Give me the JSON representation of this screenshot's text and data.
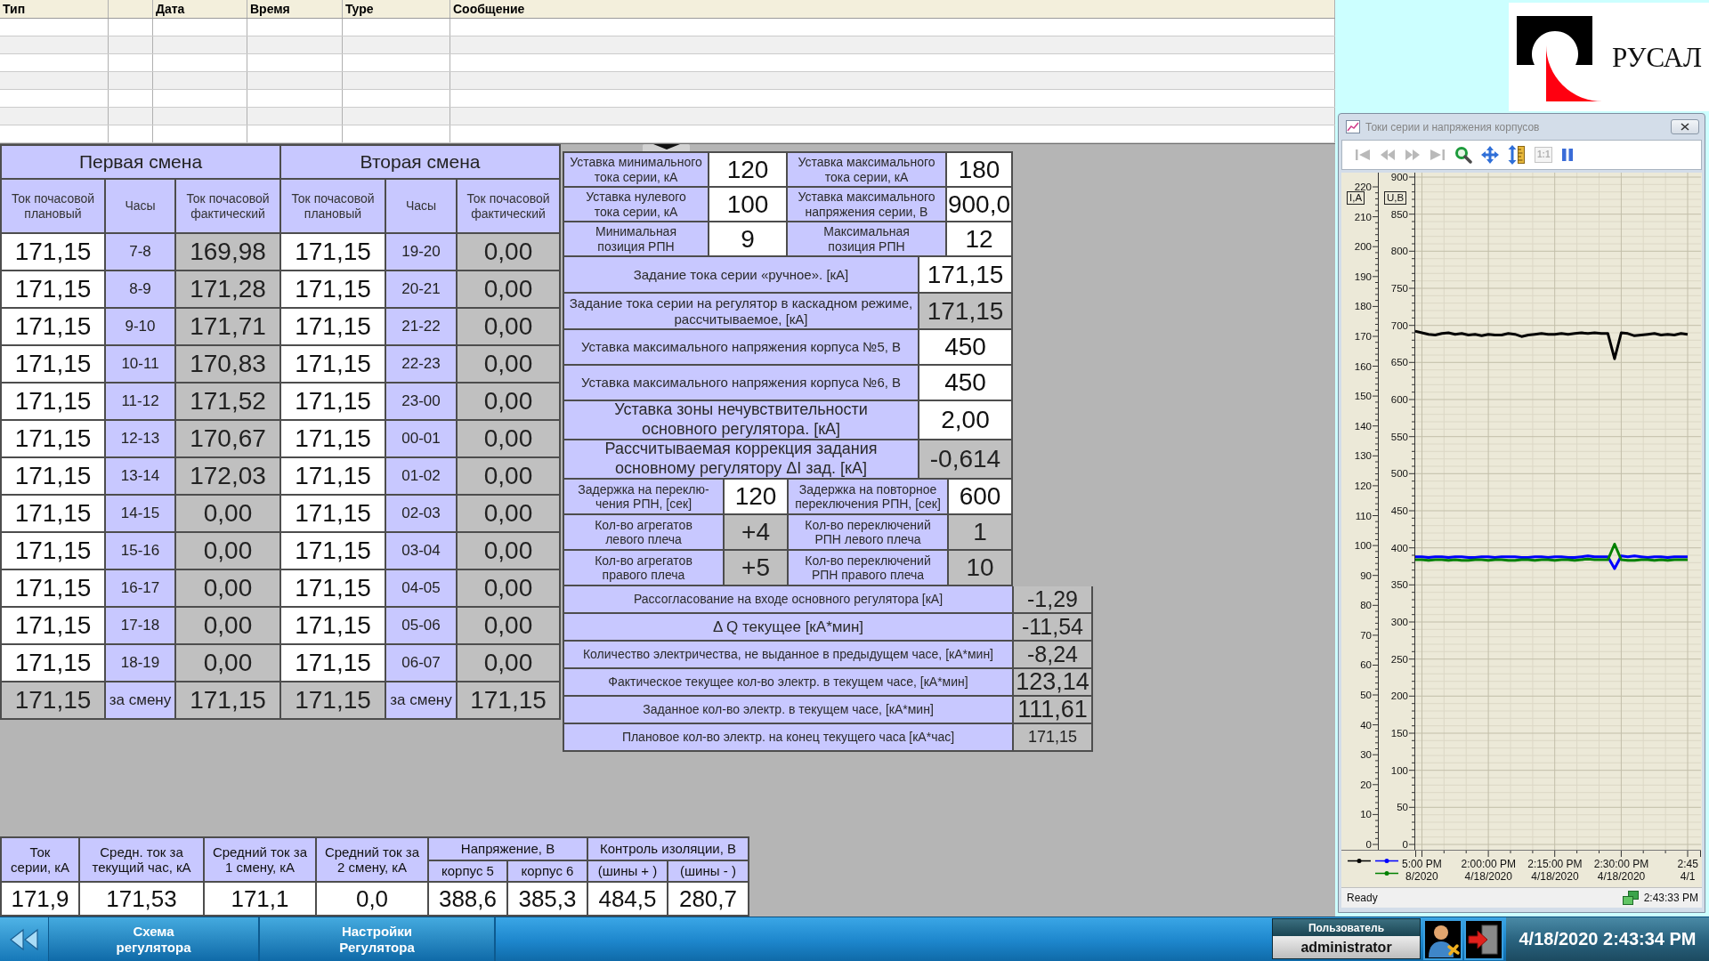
{
  "event_log": {
    "columns": [
      {
        "kind": "text",
        "label": "Тип"
      },
      {
        "kind": "blank"
      },
      {
        "kind": "text",
        "label": "Дата"
      },
      {
        "kind": "text",
        "label": "Время"
      },
      {
        "kind": "text",
        "label": "Type"
      },
      {
        "kind": "text",
        "label": "Сообщение"
      }
    ]
  },
  "logo": {
    "text": "РУСАЛ"
  },
  "shift_table": {
    "shifts": [
      {
        "title": "Первая смена",
        "columns": [
          "Ток почасовой плановый",
          "Часы",
          "Ток почасовой фактический"
        ],
        "rows": [
          {
            "planned": "171,15",
            "hours": "7-8",
            "actual": "169,98"
          },
          {
            "planned": "171,15",
            "hours": "8-9",
            "actual": "171,28"
          },
          {
            "planned": "171,15",
            "hours": "9-10",
            "actual": "171,71"
          },
          {
            "planned": "171,15",
            "hours": "10-11",
            "actual": "170,83"
          },
          {
            "planned": "171,15",
            "hours": "11-12",
            "actual": "171,52"
          },
          {
            "planned": "171,15",
            "hours": "12-13",
            "actual": "170,67"
          },
          {
            "planned": "171,15",
            "hours": "13-14",
            "actual": "172,03"
          },
          {
            "planned": "171,15",
            "hours": "14-15",
            "actual": "0,00"
          },
          {
            "planned": "171,15",
            "hours": "15-16",
            "actual": "0,00"
          },
          {
            "planned": "171,15",
            "hours": "16-17",
            "actual": "0,00"
          },
          {
            "planned": "171,15",
            "hours": "17-18",
            "actual": "0,00"
          },
          {
            "planned": "171,15",
            "hours": "18-19",
            "actual": "0,00"
          }
        ],
        "total": {
          "planned": "171,15",
          "hours": "за смену",
          "actual": "171,15"
        }
      },
      {
        "title": "Вторая смена",
        "columns": [
          "Ток почасовой плановый",
          "Часы",
          "Ток почасовой фактический"
        ],
        "rows": [
          {
            "planned": "171,15",
            "hours": "19-20",
            "actual": "0,00"
          },
          {
            "planned": "171,15",
            "hours": "20-21",
            "actual": "0,00"
          },
          {
            "planned": "171,15",
            "hours": "21-22",
            "actual": "0,00"
          },
          {
            "planned": "171,15",
            "hours": "22-23",
            "actual": "0,00"
          },
          {
            "planned": "171,15",
            "hours": "23-00",
            "actual": "0,00"
          },
          {
            "planned": "171,15",
            "hours": "00-01",
            "actual": "0,00"
          },
          {
            "planned": "171,15",
            "hours": "01-02",
            "actual": "0,00"
          },
          {
            "planned": "171,15",
            "hours": "02-03",
            "actual": "0,00"
          },
          {
            "planned": "171,15",
            "hours": "03-04",
            "actual": "0,00"
          },
          {
            "planned": "171,15",
            "hours": "04-05",
            "actual": "0,00"
          },
          {
            "planned": "171,15",
            "hours": "05-06",
            "actual": "0,00"
          },
          {
            "planned": "171,15",
            "hours": "06-07",
            "actual": "0,00"
          }
        ],
        "total": {
          "planned": "171,15",
          "hours": "за смену",
          "actual": "171,15"
        }
      }
    ]
  },
  "settings": {
    "limits": [
      {
        "cells": [
          {
            "label": "Уставка минимального\nтока серии, кА",
            "value": "120",
            "editable": true
          },
          {
            "label": "Уставка максимального\nтока серии, кА",
            "value": "180",
            "editable": true
          }
        ]
      },
      {
        "cells": [
          {
            "label": "Уставка нулевого\nтока серии, кА",
            "value": "100",
            "editable": true
          },
          {
            "label": "Уставка максимального\nнапряжения серии, В",
            "value": "900,0",
            "editable": true
          }
        ]
      },
      {
        "cells": [
          {
            "label": "Минимальная\nпозиция РПН",
            "value": "9",
            "editable": true
          },
          {
            "label": "Максимальная\nпозиция РПН",
            "value": "12",
            "editable": true
          }
        ]
      }
    ],
    "tasks": [
      {
        "label": "Задание тока серии «ручное». [кА]",
        "value": "171,15",
        "editable": true
      },
      {
        "label": "Задание тока серии на регулятор в каскадном режиме,\nрассчитываемое, [кА]",
        "value": "171,15",
        "editable": false
      },
      {
        "label": "Уставка максимального напряжения корпуса №5, В",
        "value": "450",
        "editable": true
      },
      {
        "label": "Уставка максимального напряжения корпуса №6, В",
        "value": "450",
        "editable": true
      },
      {
        "label": "Уставка зоны нечувствительности\nосновного регулятора. [кА]",
        "value": "2,00",
        "editable": true
      },
      {
        "label": "Рассчитываемая коррекция задания\nосновному регулятору ΔI зад. [кА]",
        "value": "-0,614",
        "editable": false
      }
    ],
    "switching": [
      {
        "cells": [
          {
            "label": "Задержка на переклю-\nчения РПН, [сек]",
            "value": "120",
            "editable": true
          },
          {
            "label": "Задержка на повторное\nпереключения РПН, [сек]",
            "value": "600",
            "editable": true
          }
        ]
      },
      {
        "cells": [
          {
            "label": "Кол-во агрегатов\nлевого плеча",
            "value": "+4",
            "editable": false
          },
          {
            "label": "Кол-во переключений\nРПН левого плеча",
            "value": "1",
            "editable": false
          }
        ]
      },
      {
        "cells": [
          {
            "label": "Кол-во агрегатов\nправого плеча",
            "value": "+5",
            "editable": false
          },
          {
            "label": "Кол-во переключений\nРПН правого плеча",
            "value": "10",
            "editable": false
          }
        ]
      }
    ],
    "energy": [
      {
        "label": "Рассогласование на входе основного регулятора [кА]",
        "value": "-1,29",
        "editable": false
      },
      {
        "label": "Δ Q текущее [кА*мин]",
        "value": "-11,54",
        "editable": false
      },
      {
        "label": "Количество электричества, не выданное в предыдущем часе, [кА*мин]",
        "value": "-8,24",
        "editable": false
      },
      {
        "label": "Фактическое текущее кол-во электр. в текущем часе, [кА*мин]",
        "value": "123,14",
        "editable": false
      },
      {
        "label": "Заданное кол-во электр. в текущем часе, [кА*мин]",
        "value": "111,61",
        "editable": false
      },
      {
        "label": "Плановое кол-во электр. на конец текущего часа [кА*час]",
        "value": "171,15",
        "editable": false
      }
    ]
  },
  "readings": [
    {
      "kind": "single",
      "label": "Ток\nсерии, кА",
      "value": "171,9"
    },
    {
      "kind": "single",
      "label": "Средн. ток за\nтекущий час, кА",
      "value": "171,53"
    },
    {
      "kind": "single",
      "label": "Средний ток за\n1 смену, кА",
      "value": "171,1"
    },
    {
      "kind": "single",
      "label": "Средний ток за\n2 смену, кА",
      "value": "0,0"
    },
    {
      "kind": "group",
      "label": "Напряжение, В",
      "items": [
        {
          "label": "корпус 5",
          "value": "388,6"
        },
        {
          "label": "корпус 6",
          "value": "385,3"
        }
      ]
    },
    {
      "kind": "group",
      "label": "Контроль изоляции, В",
      "items": [
        {
          "label": "(шины + )",
          "value": "484,5"
        },
        {
          "label": "(шины - )",
          "value": "280,7"
        }
      ]
    }
  ],
  "chart_window": {
    "title": "Токи серии и напряжения корпусов",
    "toolbar": [
      {
        "kind": "first",
        "disabled": true
      },
      {
        "kind": "prev",
        "disabled": true
      },
      {
        "kind": "next",
        "disabled": true
      },
      {
        "kind": "last",
        "disabled": true
      },
      {
        "kind": "zoom",
        "disabled": false
      },
      {
        "kind": "pan",
        "disabled": false
      },
      {
        "kind": "scale",
        "disabled": false
      },
      {
        "kind": "fit",
        "label": "1:1",
        "disabled": true
      },
      {
        "kind": "pause",
        "disabled": false
      }
    ],
    "current_axis": {
      "label": "I,A",
      "ticks": [
        "220",
        "210",
        "200",
        "190",
        "180",
        "170",
        "160",
        "150",
        "140",
        "130",
        "120",
        "110",
        "100",
        "90",
        "80",
        "70",
        "60",
        "50",
        "40",
        "30",
        "20",
        "10",
        "0"
      ]
    },
    "chart_data": {
      "type": "line",
      "ylabel": "U,B",
      "grid": true,
      "categories": [
        null,
        "5:00 PM\n8/2020",
        null,
        null,
        null,
        null,
        null,
        null,
        null,
        null,
        null,
        "2:00:00 PM\n4/18/2020",
        null,
        null,
        null,
        null,
        null,
        null,
        null,
        null,
        null,
        "2:15:00 PM\n4/18/2020",
        null,
        null,
        null,
        null,
        null,
        null,
        null,
        null,
        null,
        "2:30:00 PM\n4/18/2020",
        null,
        null,
        null,
        null,
        null,
        null,
        null,
        null,
        null,
        "2:45\n4/1"
      ],
      "ylim": [
        0,
        900
      ],
      "yticks": [
        0,
        50,
        100,
        150,
        200,
        250,
        300,
        350,
        400,
        450,
        500,
        550,
        600,
        650,
        700,
        750,
        800,
        850,
        900
      ],
      "series": [
        {
          "color": "#000000",
          "values": [
            692,
            690,
            688,
            687,
            689,
            690,
            688,
            689,
            687,
            688,
            686,
            688,
            687,
            687,
            689,
            688,
            685,
            687,
            688,
            689,
            688,
            688,
            689,
            688,
            689,
            690,
            689,
            690,
            689,
            689,
            655,
            690,
            689,
            686,
            687,
            688,
            689,
            687,
            688,
            687,
            689,
            688
          ]
        },
        {
          "color": "#0000ff",
          "values": [
            388,
            388,
            387,
            388,
            388,
            387,
            388,
            388,
            387,
            387,
            388,
            388,
            387,
            388,
            388,
            388,
            387,
            387,
            388,
            388,
            387,
            388,
            388,
            387,
            387,
            388,
            389,
            388,
            388,
            388,
            372,
            389,
            388,
            389,
            388,
            387,
            388,
            388,
            387,
            388,
            388,
            388
          ]
        },
        {
          "color": "#008000",
          "values": [
            384,
            384,
            383,
            384,
            384,
            383,
            384,
            383,
            383,
            384,
            384,
            383,
            384,
            384,
            383,
            383,
            384,
            384,
            383,
            384,
            384,
            383,
            384,
            384,
            383,
            384,
            385,
            384,
            384,
            384,
            405,
            384,
            383,
            383,
            384,
            384,
            383,
            384,
            383,
            384,
            384,
            384
          ]
        }
      ]
    },
    "status": "Ready",
    "status_time": "2:43:33 PM"
  },
  "nav": {
    "buttons": [
      {
        "label": "Схема\nрегулятора"
      },
      {
        "label": "Настройки\nРегулятора"
      }
    ],
    "user_caption": "Пользователь",
    "user_name": "administrator",
    "datetime": "4/18/2020 2:43:34 PM"
  }
}
